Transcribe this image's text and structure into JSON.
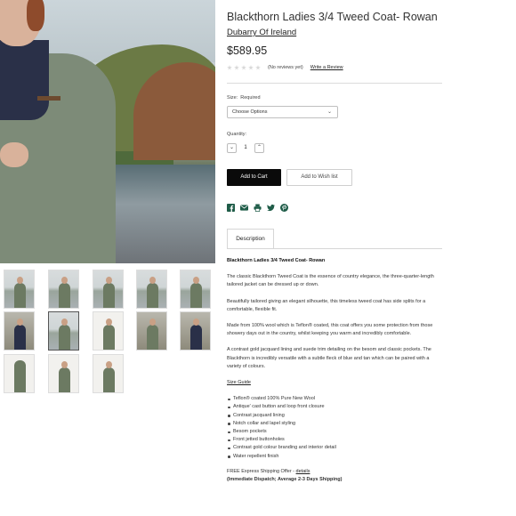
{
  "product": {
    "title": "Blackthorn Ladies 3/4 Tweed Coat- Rowan",
    "brand": "Dubarry Of Ireland",
    "price": "$589.95",
    "rating": {
      "stars_filled": 0,
      "stars_total": 5,
      "reviews_text": "(No reviews yet)",
      "write_review_label": "Write a Review"
    }
  },
  "options": {
    "size_label": "Size:",
    "size_required": "Required",
    "size_selected": "Choose Options",
    "quantity_label": "Quantity:",
    "quantity_value": "1"
  },
  "actions": {
    "add_to_cart": "Add to Cart",
    "add_to_wishlist": "Add to Wish list"
  },
  "share_icons": [
    "facebook-icon",
    "email-icon",
    "print-icon",
    "twitter-icon",
    "pinterest-icon"
  ],
  "colors": {
    "accent": "#0a0a0a",
    "share_icon": "#1f5c48"
  },
  "tabs": [
    {
      "label": "Description"
    }
  ],
  "description": {
    "heading": "Blackthorn Ladies 3/4 Tweed Coat- Rowan",
    "paragraphs": [
      "The classic Blackthorn Tweed Coat is the essence of country elegance, the three-quarter-length tailored jacket can be dressed up or down.",
      "Beautifully tailored giving an elegant silhouette, this timeless tweed coat has side splits for a comfortable, flexible fit.",
      "Made from 100% wool which is Teflon® coated, this coat offers you some protection from those showery days out in the country, whilst keeping you warm and incredibly comfortable.",
      "A contrast gold jacquard lining and suede trim detailing on the besom and classic pockets. The Blackthorn is incredibly versatile with a subtle fleck of blue and tan which can be paired with a variety of colours."
    ],
    "size_guide_label": "Size Guide",
    "features": [
      "Teflon® coated 100% Pure New Wool",
      "Antique' cast button and loop front closure",
      "Contrast jacquard lining",
      "Notch collar and lapel styling",
      "Besom pockets",
      "Front jetted buttonholes",
      "Contrast gold colour branding and interior detail",
      "Water repellent finish"
    ],
    "shipping_offer": "FREE Express Shipping Offer - ",
    "shipping_link": "details",
    "dispatch_note": "(Immediate Dispatch; Average 2-3 Days Shipping)"
  },
  "gallery": {
    "selected_index": 6,
    "thumbnail_count": 13
  }
}
